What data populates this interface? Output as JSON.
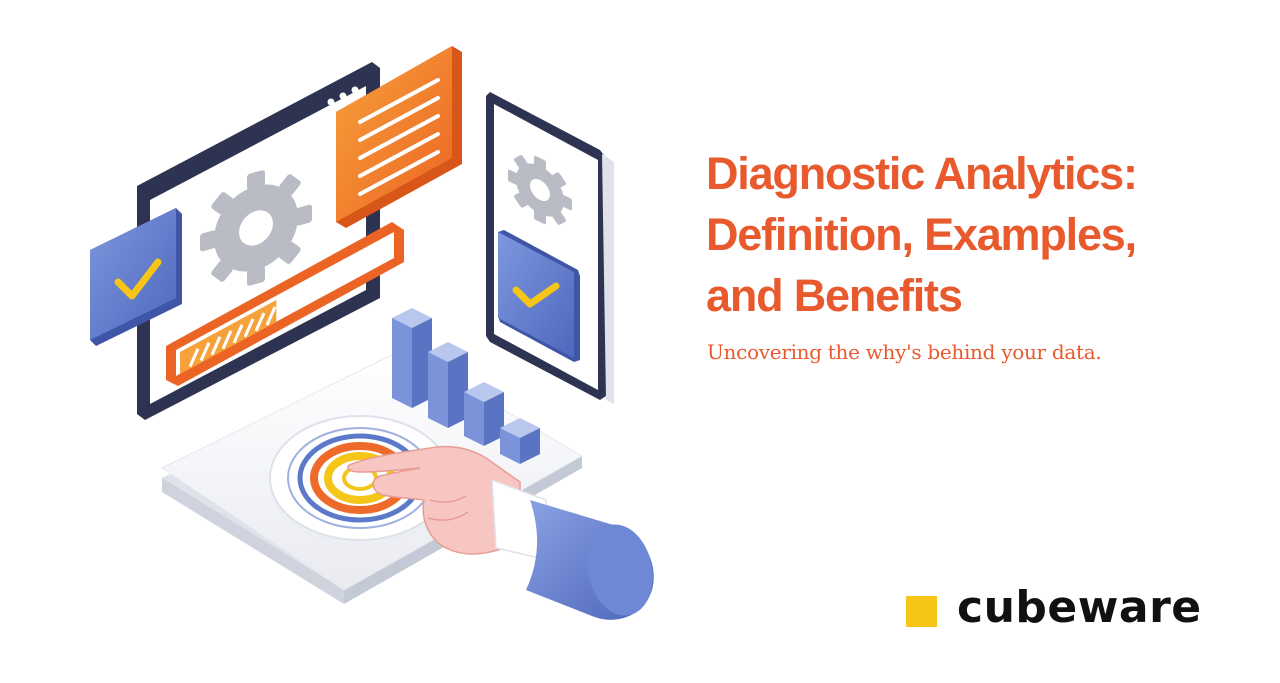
{
  "heading": {
    "lines": [
      "Diagnostic Analytics:",
      "Definition, Examples,",
      "and Benefits"
    ]
  },
  "subtitle": "Uncovering the why's behind your data.",
  "brand": {
    "name": "cubeware",
    "square_color": "#f5c518"
  },
  "colors": {
    "accent": "#e85a2e",
    "blue": "#5b78c9",
    "navy": "#2e3352",
    "orange": "#f07a2a",
    "yellow": "#f5c518"
  },
  "illustration": {
    "icons": [
      "browser-window-icon",
      "gear-icon",
      "checkmark-icon",
      "document-icon",
      "progress-bar-icon",
      "phone-icon",
      "bar-chart-icon",
      "target-dial-icon",
      "pointing-hand-icon"
    ],
    "progress_fraction": 0.45
  }
}
